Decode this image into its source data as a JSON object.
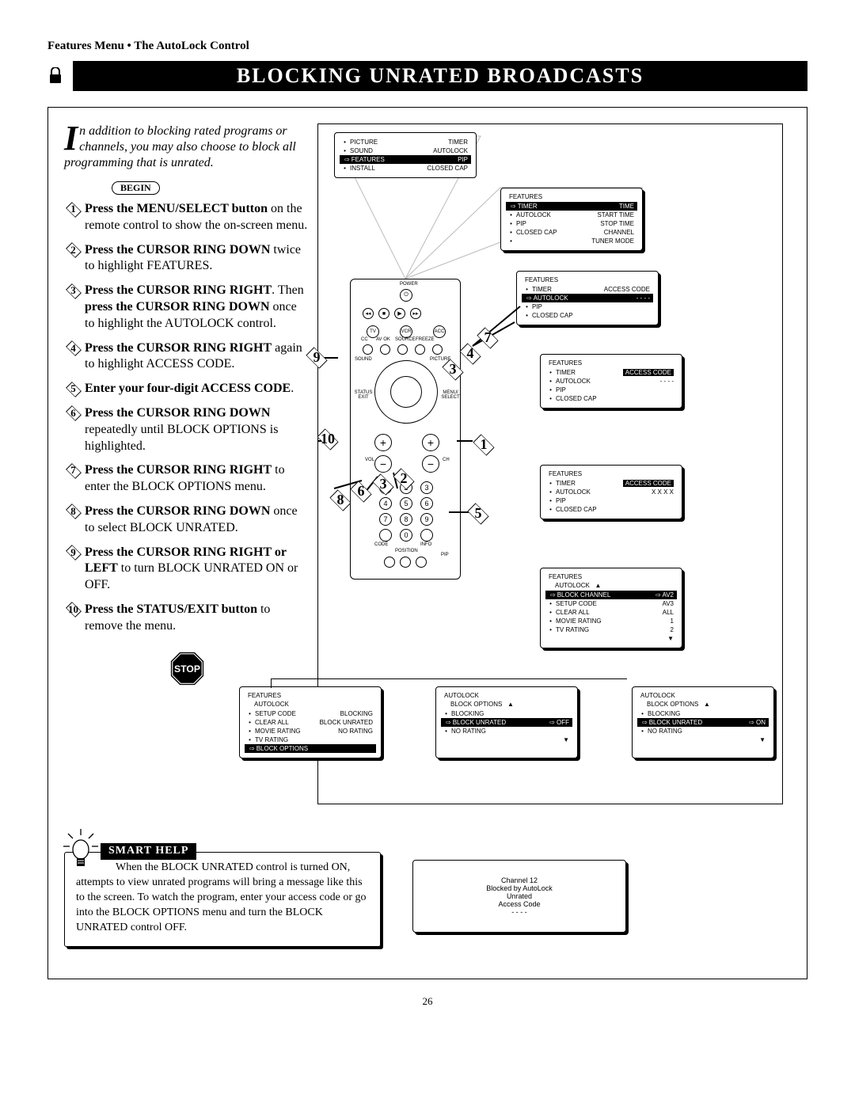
{
  "breadcrumb": "Features Menu • The AutoLock Control",
  "title": "BLOCKING UNRATED BROADCASTS",
  "intro": "n addition to blocking rated programs or channels, you may also choose to block all programming that is unrated.",
  "dropcap": "I",
  "begin": "BEGIN",
  "steps": [
    {
      "n": "1",
      "bold": "Press the MENU/SELECT button",
      "rest": " on the remote control to show the on-screen menu."
    },
    {
      "n": "2",
      "bold": "Press the CURSOR RING DOWN",
      "rest": " twice to highlight FEATURES."
    },
    {
      "n": "3",
      "bold": "Press the CURSOR RING RIGHT",
      "rest": ". Then ",
      "bold2": "press the CURSOR RING DOWN",
      "rest2": " once to highlight the AUTOLOCK control."
    },
    {
      "n": "4",
      "bold": "Press the CURSOR RING RIGHT",
      "rest": " again to highlight ACCESS CODE."
    },
    {
      "n": "5",
      "bold": "Enter your four-digit ACCESS CODE",
      "rest": "."
    },
    {
      "n": "6",
      "bold": "Press the CURSOR RING DOWN",
      "rest": " repeatedly until BLOCK OPTIONS is highlighted."
    },
    {
      "n": "7",
      "bold": "Press the CURSOR RING RIGHT",
      "rest": " to enter the BLOCK OPTIONS menu."
    },
    {
      "n": "8",
      "bold": "Press the CURSOR RING DOWN",
      "rest": " once to select BLOCK UNRATED."
    },
    {
      "n": "9",
      "bold": "Press the CURSOR RING RIGHT or LEFT",
      "rest": " to turn BLOCK UNRATED ON or OFF."
    },
    {
      "n": "10",
      "bold": "Press the STATUS/EXIT button",
      "rest": " to remove the menu."
    }
  ],
  "osd_main": {
    "rows": [
      {
        "lbl": "PICTURE",
        "val": "TIMER"
      },
      {
        "lbl": "SOUND",
        "val": "AUTOLOCK"
      },
      {
        "lbl": "FEATURES",
        "val": "PIP",
        "sel": true,
        "arrow": true
      },
      {
        "lbl": "INSTALL",
        "val": "CLOSED CAP"
      }
    ]
  },
  "osd_f1": {
    "hdr": "FEATURES",
    "rows": [
      {
        "lbl": "TIMER",
        "val": "TIME",
        "sel": true,
        "arrow": true
      },
      {
        "lbl": "AUTOLOCK",
        "val": "START TIME"
      },
      {
        "lbl": "PIP",
        "val": "STOP TIME"
      },
      {
        "lbl": "CLOSED CAP",
        "val": "CHANNEL"
      },
      {
        "lbl": "",
        "val": "TUNER MODE"
      }
    ]
  },
  "osd_f2": {
    "hdr": "FEATURES",
    "rows": [
      {
        "lbl": "TIMER",
        "val": "ACCESS CODE"
      },
      {
        "lbl": "AUTOLOCK",
        "val": "- - - -",
        "sel": true,
        "arrow": true
      },
      {
        "lbl": "PIP",
        "val": ""
      },
      {
        "lbl": "CLOSED CAP",
        "val": ""
      }
    ]
  },
  "osd_f3": {
    "hdr": "FEATURES",
    "rows": [
      {
        "lbl": "TIMER",
        "val": "ACCESS CODE",
        "valsel": true
      },
      {
        "lbl": "AUTOLOCK",
        "val": "- - - -"
      },
      {
        "lbl": "PIP",
        "val": ""
      },
      {
        "lbl": "CLOSED CAP",
        "val": ""
      }
    ]
  },
  "osd_f4": {
    "hdr": "FEATURES",
    "rows": [
      {
        "lbl": "TIMER",
        "val": "ACCESS CODE",
        "valsel": true
      },
      {
        "lbl": "AUTOLOCK",
        "val": "X X X X"
      },
      {
        "lbl": "PIP",
        "val": ""
      },
      {
        "lbl": "CLOSED CAP",
        "val": ""
      }
    ]
  },
  "osd_f5": {
    "hdr": "FEATURES",
    "sub": "AUTOLOCK",
    "rows": [
      {
        "lbl": "BLOCK CHANNEL",
        "val": "AV2",
        "sel": true,
        "arrow": true,
        "arrowpost": true
      },
      {
        "lbl": "SETUP CODE",
        "val": "AV3"
      },
      {
        "lbl": "CLEAR ALL",
        "val": "ALL"
      },
      {
        "lbl": "MOVIE RATING",
        "val": "1"
      },
      {
        "lbl": "TV RATING",
        "val": "2"
      }
    ]
  },
  "osd_b1": {
    "hdr": "FEATURES",
    "sub": "AUTOLOCK",
    "rows": [
      {
        "lbl": "SETUP CODE",
        "val": "BLOCKING"
      },
      {
        "lbl": "CLEAR ALL",
        "val": "BLOCK UNRATED"
      },
      {
        "lbl": "MOVIE RATING",
        "val": "NO RATING"
      },
      {
        "lbl": "TV RATING",
        "val": ""
      },
      {
        "lbl": "BLOCK OPTIONS",
        "val": "",
        "sel": true,
        "arrow": true
      }
    ]
  },
  "osd_b2": {
    "hdr": "AUTOLOCK",
    "sub": "BLOCK OPTIONS",
    "rows": [
      {
        "lbl": "BLOCKING",
        "val": ""
      },
      {
        "lbl": "BLOCK UNRATED",
        "val": "OFF",
        "sel": true,
        "arrow": true,
        "arrowpost": true
      },
      {
        "lbl": "NO RATING",
        "val": ""
      }
    ]
  },
  "osd_b3": {
    "hdr": "AUTOLOCK",
    "sub": "BLOCK OPTIONS",
    "rows": [
      {
        "lbl": "BLOCKING",
        "val": ""
      },
      {
        "lbl": "BLOCK UNRATED",
        "val": "ON",
        "sel": true,
        "arrow": true,
        "arrowpost": true
      },
      {
        "lbl": "NO RATING",
        "val": ""
      }
    ]
  },
  "remote_labels": {
    "power": "POWER",
    "tv": "TV",
    "vcr": "VCR",
    "acc": "ACC",
    "cc": "CC",
    "avok": "AV OK",
    "source": "SOURCE",
    "freeze": "FREEZE",
    "sound": "SOUND",
    "picture": "PICTURE",
    "status_exit": "STATUS\\nEXIT",
    "menu_select": "MENU/\\nSELECT",
    "vol": "VOL",
    "ch": "CH",
    "code": "CODE",
    "info": "INFO",
    "position": "POSITION",
    "pip": "PIP"
  },
  "smart_help": {
    "tag": "SMART HELP",
    "text": "When the BLOCK UNRATED control is turned ON, attempts to view unrated programs will bring a message like this to the screen. To watch the program, enter your access code or go into the BLOCK OPTIONS menu and turn the BLOCK UNRATED control OFF."
  },
  "help_screen": {
    "l1": "Channel 12",
    "l2": "Blocked by AutoLock",
    "l3": "Unrated",
    "l4": "Access Code",
    "l5": "- - - -"
  },
  "stop": "STOP",
  "page": "26"
}
